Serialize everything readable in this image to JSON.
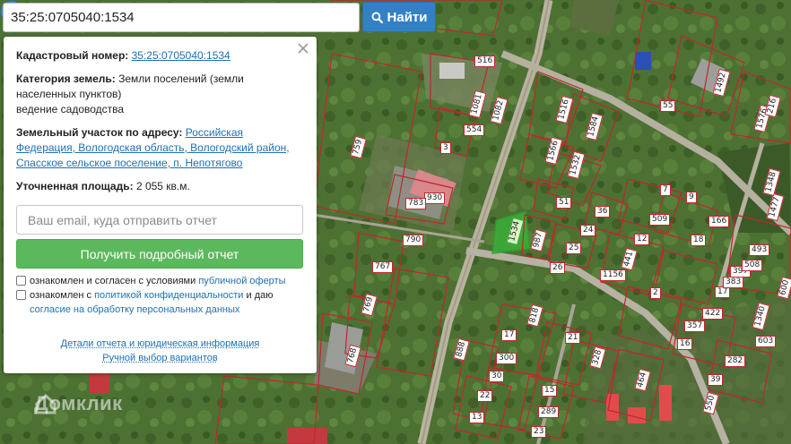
{
  "search": {
    "value": "35:25:0705040:1534",
    "button_label": "Найти"
  },
  "panel": {
    "cadastral_label": "Кадастровый номер:",
    "cadastral_value": "35:25:0705040:1534",
    "category_label": "Категория земель:",
    "category_value": "Земли поселений (земли населенных пунктов)",
    "usage": "ведение садоводства",
    "address_label": "Земельный участок по адресу:",
    "address_value": "Российская Федерация, Вологодская область, Вологодский район, Спасское сельское поселение, п. Непотягово",
    "area_label": "Уточненная площадь:",
    "area_value": "2 055 кв.м.",
    "email_placeholder": "Ваш email, куда отправить отчет",
    "report_button": "Получить подробный отчет",
    "consent1_text": "ознакомлен и согласен с условиями",
    "consent1_link": "публичной оферты",
    "consent2_text1": "ознакомлен с",
    "consent2_link1": "политикой конфиденциальности",
    "consent2_text2": "и даю",
    "consent2_link2": "согласие на обработку персональных данных",
    "details_link": "Детали отчета и юридическая информация",
    "manual_link": "Ручной выбор вариантов"
  },
  "watermark": "Домклик",
  "icons": {
    "search": "search-icon",
    "close": "close-icon",
    "marker": "map-marker-icon"
  },
  "colors": {
    "accent": "#3380c5",
    "report_button": "#5cb85c",
    "parcel_border": "#c0272d",
    "highlight": "#2f9a2f"
  },
  "parcel_labels": [
    "1534",
    "516",
    "1081",
    "1082",
    "554",
    "3",
    "759",
    "930",
    "783",
    "790",
    "767",
    "769",
    "768",
    "888",
    "1516",
    "1584",
    "1566",
    "1532",
    "51",
    "7",
    "9",
    "36",
    "509",
    "166",
    "24",
    "12",
    "18",
    "987",
    "25",
    "441",
    "26",
    "1156",
    "2",
    "17",
    "422",
    "357",
    "16",
    "282",
    "39",
    "550",
    "603",
    "1340",
    "600",
    "397",
    "383",
    "508",
    "493",
    "1477",
    "1348",
    "1576",
    "216",
    "1492",
    "55",
    "818",
    "17",
    "21",
    "300",
    "328",
    "30",
    "15",
    "22",
    "289",
    "13",
    "23",
    "464"
  ]
}
